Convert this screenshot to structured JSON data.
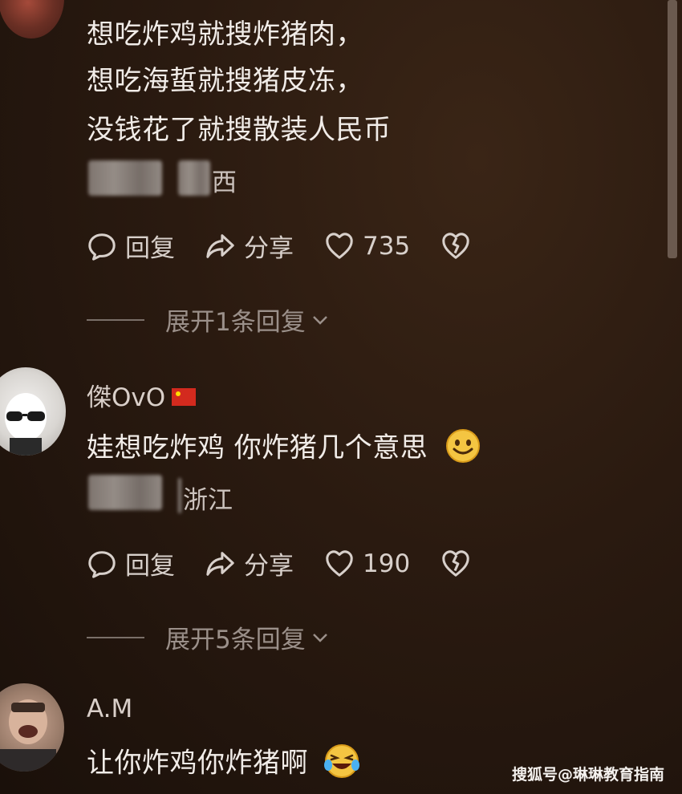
{
  "comments": [
    {
      "lines": [
        "想吃炸鸡就搜炸猪肉，",
        "想吃海蜇就搜猪皮冻，",
        "没钱花了就搜散装人民币"
      ],
      "location": "西",
      "reply_label": "回复",
      "share_label": "分享",
      "likes": "735",
      "expand_label": "展开1条回复"
    },
    {
      "username": "傑OvO",
      "text": "娃想吃炸鸡 你炸猪几个意思",
      "location": "浙江",
      "reply_label": "回复",
      "share_label": "分享",
      "likes": "190",
      "expand_label": "展开5条回复"
    },
    {
      "username": "A.M",
      "text": "让你炸鸡你炸猪啊"
    }
  ],
  "watermark": "搜狐号@琳琳教育指南",
  "icons": {
    "reply": "comment-bubble-icon",
    "share": "share-arrow-icon",
    "like": "heart-icon",
    "dislike": "broken-heart-icon",
    "expand": "chevron-down-icon",
    "flag": "china-flag-icon"
  },
  "colors": {
    "background": "#2a1a10",
    "text": "#f1ece8",
    "muted": "#9b908a"
  }
}
